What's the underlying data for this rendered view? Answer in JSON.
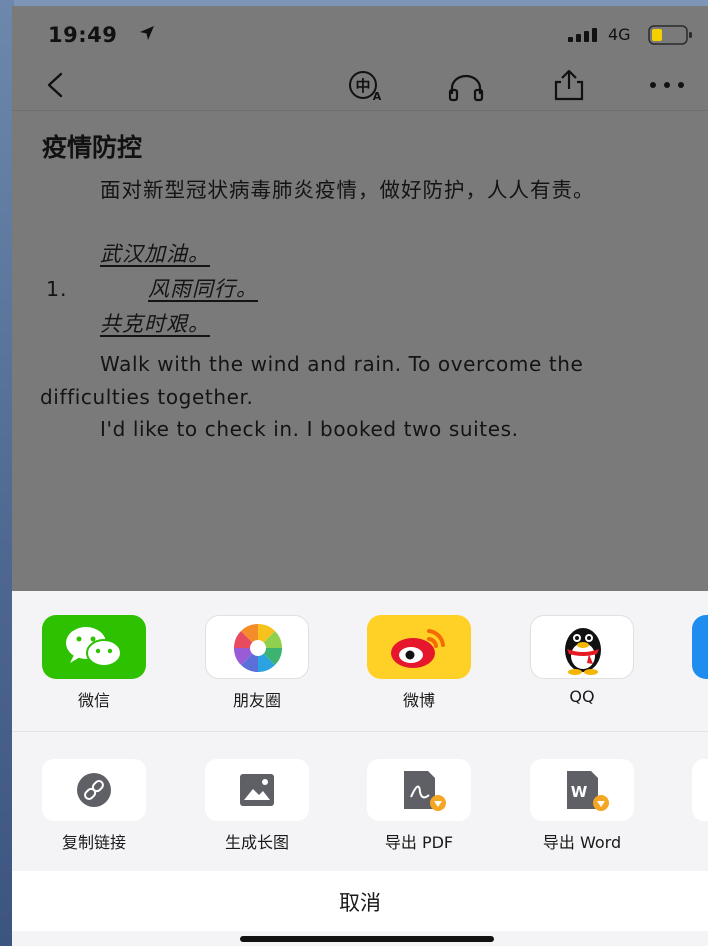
{
  "status_bar": {
    "time": "19:49",
    "network": "4G",
    "battery_color": "#f5d000"
  },
  "nav": {
    "icons": [
      "back-icon",
      "translate-icon",
      "headphones-icon",
      "share-icon",
      "more-icon"
    ]
  },
  "document": {
    "title": "疫情防控",
    "para1": "面对新型冠状病毒肺炎疫情，做好防护，人人有责。",
    "item1": "武汉加油。",
    "list_number": "1.",
    "item2": "风雨同行。",
    "item3": "共克时艰。",
    "english1": "Walk with the wind and rain. To overcome the difficulties together.",
    "english2": "I'd like to check in. I booked two suites."
  },
  "share_sheet": {
    "apps": [
      {
        "label": "微信",
        "icon": "wechat-icon",
        "color": "#2dc100"
      },
      {
        "label": "朋友圈",
        "icon": "moments-icon",
        "color": "#ffffff"
      },
      {
        "label": "微博",
        "icon": "weibo-icon",
        "color": "#ffd026"
      },
      {
        "label": "QQ",
        "icon": "qq-icon",
        "color": "#ffffff"
      }
    ],
    "actions": [
      {
        "label": "复制链接",
        "icon": "link-icon"
      },
      {
        "label": "生成长图",
        "icon": "image-icon"
      },
      {
        "label": "导出 PDF",
        "icon": "pdf-icon"
      },
      {
        "label": "导出 Word",
        "icon": "word-icon"
      }
    ],
    "cancel_label": "取消"
  }
}
